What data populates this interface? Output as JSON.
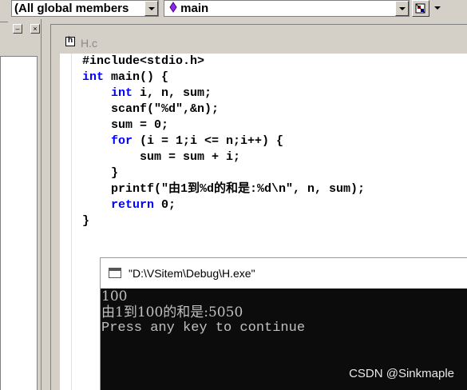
{
  "toolbar": {
    "scope_combo": "(All global members",
    "member_combo": "main"
  },
  "editor": {
    "tab_title": "H.c",
    "code_lines": [
      {
        "indent": "",
        "text": "#include<stdio.h>"
      },
      {
        "indent": "",
        "kw": "int",
        "text": " main() {"
      },
      {
        "indent": "    ",
        "kw": "int",
        "text": " i, n, sum;"
      },
      {
        "indent": "    ",
        "text": "scanf(\"%d\",&n);"
      },
      {
        "indent": "    ",
        "text": "sum = 0;"
      },
      {
        "indent": "    ",
        "kw": "for",
        "text": " (i = 1;i <= n;i++) {"
      },
      {
        "indent": "        ",
        "text": "sum = sum + i;"
      },
      {
        "indent": "    ",
        "text": "}"
      },
      {
        "indent": "    ",
        "text": "printf(\"由1到%d的和是:%d\\n\", n, sum);"
      },
      {
        "indent": "    ",
        "kw": "return",
        "text": " 0;"
      },
      {
        "indent": "",
        "text": "}"
      }
    ],
    "keyword_color": "#0000ff"
  },
  "console": {
    "title": "\"D:\\VSitem\\Debug\\H.exe\"",
    "lines": [
      "100",
      "由1到100的和是:5050",
      "Press any key to continue"
    ]
  },
  "watermark": "CSDN @Sinkmaple",
  "icons": {
    "member": "purple-diamond-icon",
    "wizard": "class-wizard-icon",
    "file": "header-file-icon",
    "console": "console-window-icon"
  }
}
